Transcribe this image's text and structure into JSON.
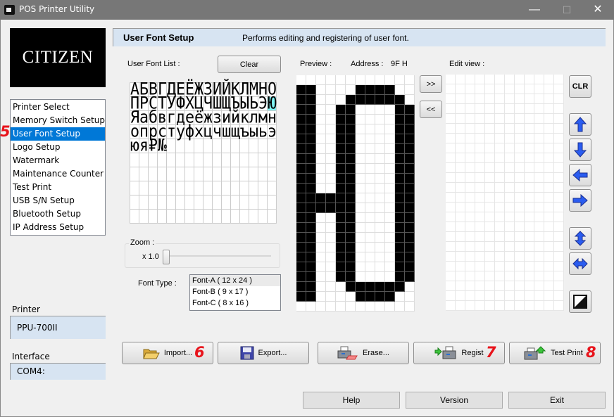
{
  "window": {
    "title": "POS Printer Utility",
    "minimize": "—",
    "maximize": "☐",
    "close": "✕"
  },
  "logo": "CITIZEN",
  "nav": {
    "items": [
      "Printer Select",
      "Memory Switch Setup",
      "User Font Setup",
      "Logo Setup",
      "Watermark",
      "Maintenance Counter",
      "Test Print",
      "USB S/N Setup",
      "Bluetooth Setup",
      "IP Address Setup"
    ],
    "selected": "User Font Setup"
  },
  "printer": {
    "label": "Printer",
    "value": "PPU-700II"
  },
  "interface": {
    "label": "Interface",
    "value": "COM4:"
  },
  "annotations": {
    "a5": "5",
    "a6": "6",
    "a7": "7",
    "a8": "8"
  },
  "header": {
    "title": "User Font Setup",
    "description": "Performs editing and registering of user font."
  },
  "font_list": {
    "label": "User Font List :",
    "clear_label": "Clear",
    "rows": [
      "АБВГДЕЁЖЗИЙКЛМНО",
      "ПРСТУФХЦЧШЩЪЫЬЭЮ",
      "Яабвгдеёжзийклмн",
      "опрстуфхцчшщъыьэ",
      "юя₽№"
    ],
    "selected_char": "Ю"
  },
  "zoom": {
    "label": "Zoom :",
    "value": "x 1.0",
    "level": 0
  },
  "font_type": {
    "label": "Font Type :",
    "options": [
      "Font-A ( 12 x 24 )",
      "Font-B ( 9 x 17 )",
      "Font-C ( 8 x 16 )"
    ],
    "selected": "Font-A ( 12 x 24 )"
  },
  "preview": {
    "label": "Preview :",
    "address_label": "Address :",
    "address_value": "9F H",
    "bitmap": [
      "000000000000",
      "110000111100",
      "110001111110",
      "110011000011",
      "110011000011",
      "110011000011",
      "110011000011",
      "110011000011",
      "110011000011",
      "110011000011",
      "110011000011",
      "110011000011",
      "111111000011",
      "111111000011",
      "110011000011",
      "110011000011",
      "110011000011",
      "110011000011",
      "110011000011",
      "110011000011",
      "110011000011",
      "110001111110",
      "110000111100",
      "000000000000"
    ]
  },
  "transfer": {
    "to_edit": ">>",
    "to_preview": "<<"
  },
  "edit_view": {
    "label": "Edit view :",
    "cols": 12,
    "rows": 24
  },
  "edit_tools": {
    "clear": "CLR",
    "icons": [
      "arrow-up-icon",
      "arrow-down-icon",
      "arrow-left-icon",
      "arrow-right-icon",
      "flip-vertical-icon",
      "flip-horizontal-icon",
      "invert-icon"
    ]
  },
  "actions": {
    "import": "Import...",
    "export": "Export...",
    "erase": "Erase...",
    "regist": "Regist",
    "test_print": "Test Print"
  },
  "footer": {
    "help": "Help",
    "version": "Version",
    "exit": "Exit"
  },
  "colors": {
    "selection": "#0078d7",
    "header_bg": "#d7e4f2",
    "annotation": "#e8141c",
    "arrow": "#2a5cf0"
  }
}
